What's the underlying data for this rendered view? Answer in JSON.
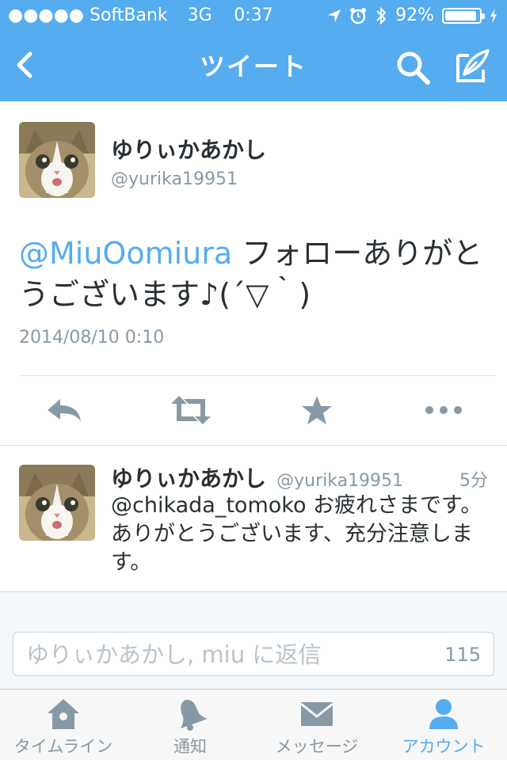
{
  "status_bar": {
    "carrier": "●●●●● SoftBank",
    "network": "3G",
    "time": "0:37",
    "battery_text": "92%",
    "battery_level": 0.92
  },
  "nav": {
    "title": "ツイート",
    "back_icon": "chevron-left-icon",
    "search_icon": "search-icon",
    "compose_icon": "compose-icon"
  },
  "tweet": {
    "author_name": "ゆりぃかあかし",
    "author_handle": "@yurika19951",
    "mention": "@MiuOomiura",
    "text": " フォローありがとうございます♪(´▽｀)",
    "timestamp": "2014/08/10 0:10",
    "actions": [
      "reply-icon",
      "retweet-icon",
      "favorite-icon",
      "more-icon"
    ]
  },
  "reply": {
    "author_name": "ゆりぃかあかし",
    "author_handle": "@yurika19951",
    "time": "5分",
    "text": "@chikada_tomoko お疲れさまです。ありがとうございます、充分注意します。"
  },
  "compose": {
    "placeholder": "ゆりぃかあかし, miu に返信",
    "char_count": "115"
  },
  "tabs": [
    {
      "label": "タイムライン",
      "icon": "home-icon"
    },
    {
      "label": "通知",
      "icon": "bell-icon"
    },
    {
      "label": "メッセージ",
      "icon": "envelope-icon"
    },
    {
      "label": "アカウント",
      "icon": "person-icon"
    }
  ],
  "colors": {
    "accent": "#55acee",
    "text": "#292f33",
    "muted": "#8899a6",
    "icon_gray": "#8899a6"
  }
}
